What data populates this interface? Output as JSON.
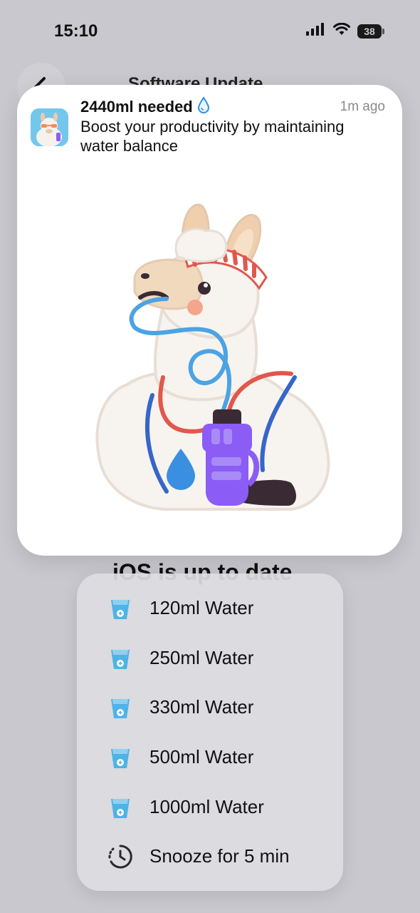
{
  "status_bar": {
    "time": "15:10",
    "battery": "38"
  },
  "background": {
    "title": "Software Update",
    "heading": "iOS is up to date"
  },
  "notification": {
    "title": "2440ml needed",
    "time": "1m ago",
    "body": "Boost your productivity by maintaining water balance",
    "app_icon": "llama-app-icon",
    "title_icon": "water-drop-icon"
  },
  "actions": [
    {
      "label": "120ml Water",
      "icon": "water-glass-icon"
    },
    {
      "label": "250ml Water",
      "icon": "water-glass-icon"
    },
    {
      "label": "330ml Water",
      "icon": "water-glass-icon"
    },
    {
      "label": "500ml Water",
      "icon": "water-glass-icon"
    },
    {
      "label": "1000ml Water",
      "icon": "water-glass-icon"
    },
    {
      "label": "Snooze for 5 min",
      "icon": "snooze-clock-icon"
    }
  ],
  "colors": {
    "accent": "#2f8fe0",
    "bottle": "#8b5cf6",
    "water_glass": "#4fb3e6"
  }
}
